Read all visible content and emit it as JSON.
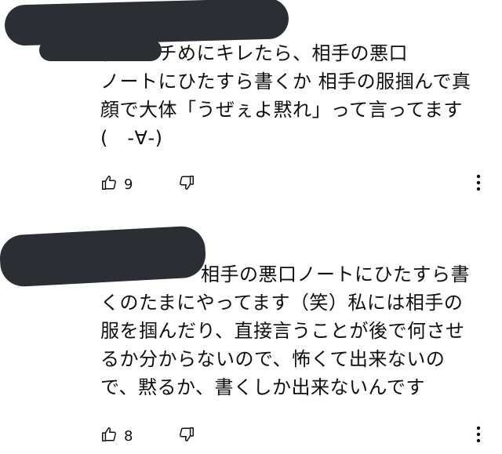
{
  "comments": [
    {
      "text": "私はガチめにキレたら、相手の悪口\nノートにひたすら書くか 相手の服掴んで真\n顔で大体「うぜぇよ黙れ」って言ってます\n(　-∀-)",
      "likes": "9"
    },
    {
      "text": "相手の悪口ノートにひたすら書\nくのたまにやってます（笑）私には相手の\n服を掴んだり、直接言うことが後で何させ\nるか分からないので、怖くて出来ないの\nで、黙るか、書くしか出来ないんです",
      "likes": "8"
    }
  ],
  "icons": {
    "like": "thumbs-up-icon",
    "dislike": "thumbs-down-icon",
    "menu": "more-vertical-icon"
  },
  "colors": {
    "text": "#0f0f0f",
    "redaction": "#2b2e33",
    "background": "#ffffff"
  }
}
